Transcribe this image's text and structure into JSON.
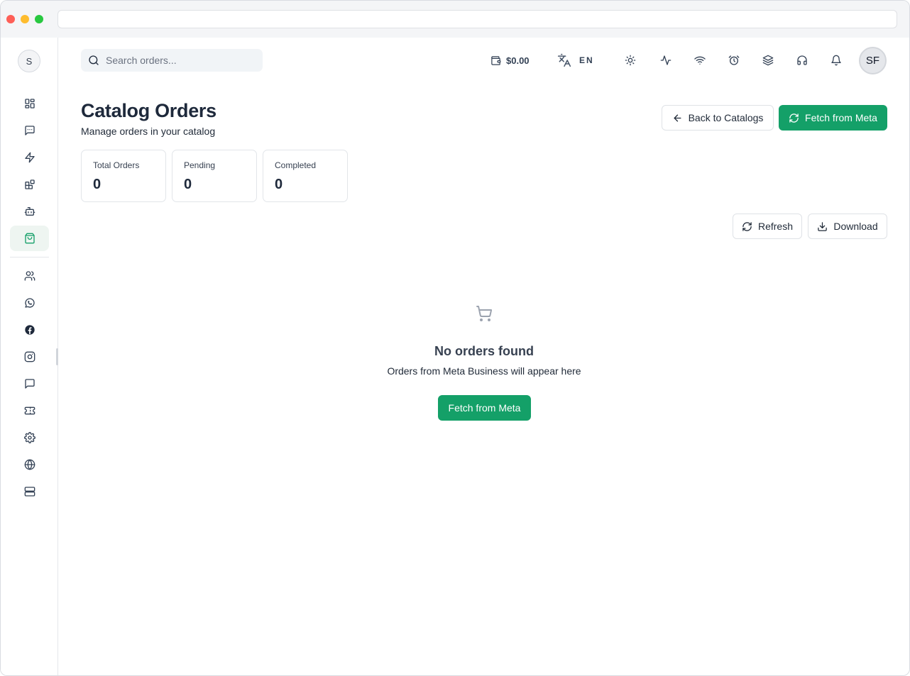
{
  "sidebar": {
    "avatar_initial": "S",
    "active_item": "catalog",
    "items_top": [
      {
        "name": "dashboard",
        "icon": "layout-grid-icon"
      },
      {
        "name": "chats",
        "icon": "message-square-icon"
      },
      {
        "name": "automation",
        "icon": "zap-icon"
      },
      {
        "name": "integrations",
        "icon": "blocks-icon"
      },
      {
        "name": "bots",
        "icon": "bot-icon"
      },
      {
        "name": "catalog",
        "icon": "shopping-bag-icon"
      }
    ],
    "items_bottom": [
      {
        "name": "contacts",
        "icon": "users-icon"
      },
      {
        "name": "whatsapp",
        "icon": "whatsapp-icon"
      },
      {
        "name": "facebook",
        "icon": "facebook-icon"
      },
      {
        "name": "instagram",
        "icon": "instagram-icon"
      },
      {
        "name": "messages",
        "icon": "message-circle-icon"
      },
      {
        "name": "tickets",
        "icon": "ticket-icon"
      },
      {
        "name": "settings",
        "icon": "settings-icon"
      },
      {
        "name": "web",
        "icon": "globe-icon"
      },
      {
        "name": "servers",
        "icon": "server-icon"
      }
    ]
  },
  "header": {
    "search_placeholder": "Search orders...",
    "balance": "$0.00",
    "language": "EN",
    "icons": [
      "sun-icon",
      "activity-icon",
      "wifi-icon",
      "alarm-clock-icon",
      "layers-icon",
      "headphones-icon",
      "bell-icon"
    ],
    "user_initials": "SF"
  },
  "page": {
    "title": "Catalog Orders",
    "subtitle": "Manage orders in your catalog",
    "back_button": "Back to Catalogs",
    "fetch_button": "Fetch from Meta",
    "refresh_button": "Refresh",
    "download_button": "Download"
  },
  "stats": [
    {
      "label": "Total Orders",
      "value": "0"
    },
    {
      "label": "Pending",
      "value": "0"
    },
    {
      "label": "Completed",
      "value": "0"
    }
  ],
  "empty_state": {
    "title": "No orders found",
    "subtitle": "Orders from Meta Business will appear here",
    "button": "Fetch from Meta"
  },
  "colors": {
    "accent": "#14a068",
    "text": "#1e293b",
    "border": "#e2e5e9"
  }
}
